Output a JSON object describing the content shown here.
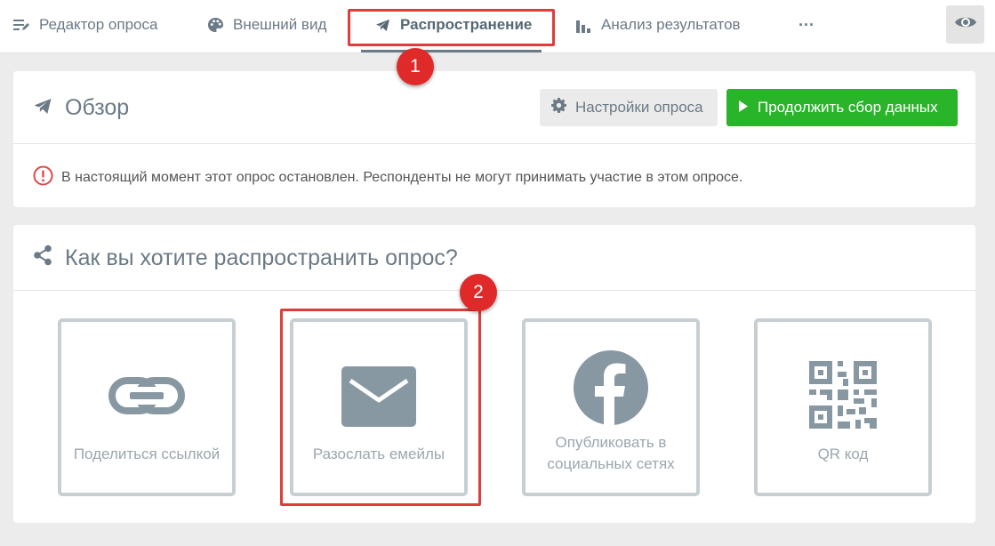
{
  "nav": {
    "items": [
      {
        "label": "Редактор опроса",
        "icon": "edit-list-icon"
      },
      {
        "label": "Внешний вид",
        "icon": "palette-icon"
      },
      {
        "label": "Распространение",
        "icon": "paper-plane-icon",
        "active": true
      },
      {
        "label": "Анализ результатов",
        "icon": "bar-chart-icon"
      }
    ],
    "more_label": "···"
  },
  "overview": {
    "title": "Обзор",
    "settings_button": "Настройки опроса",
    "continue_button": "Продолжить сбор данных",
    "notice": "В настоящий момент этот опрос остановлен. Респонденты не могут принимать участие в этом опросе."
  },
  "share": {
    "title": "Как вы хотите распространить опрос?",
    "options": [
      {
        "label": "Поделиться ссылкой",
        "icon": "link-icon"
      },
      {
        "label": "Разослать емейлы",
        "icon": "envelope-icon"
      },
      {
        "label": "Опубликовать в социальных сетях",
        "icon": "facebook-icon"
      },
      {
        "label": "QR код",
        "icon": "qr-code-icon"
      }
    ]
  },
  "annotations": {
    "badge1": "1",
    "badge2": "2"
  },
  "colors": {
    "accent": "#6b7a86",
    "continue_green": "#2ab42a",
    "annotation_red": "#e03c3c",
    "card_border": "#c8cfd3"
  }
}
